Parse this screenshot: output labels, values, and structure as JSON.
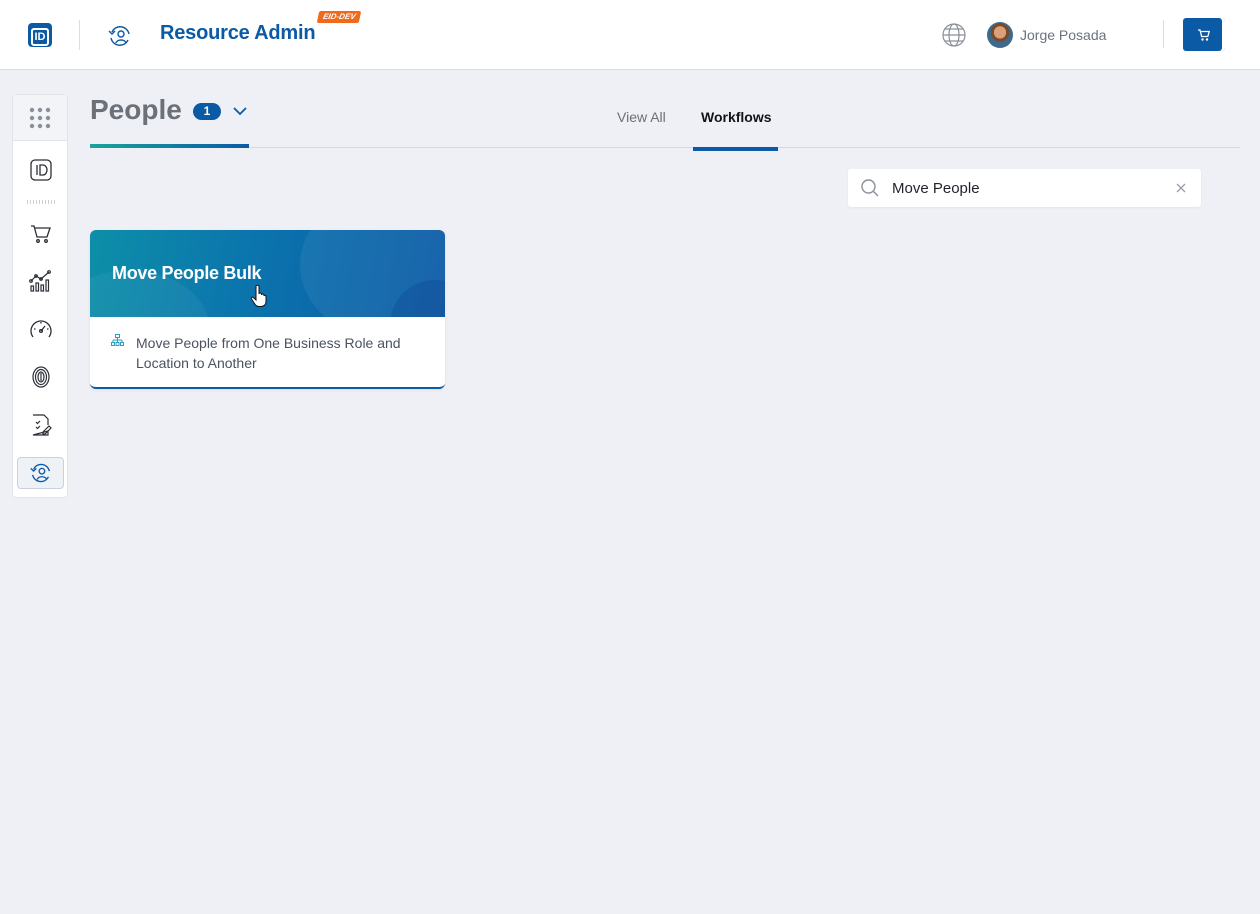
{
  "header": {
    "logo_text": "ID",
    "app_title": "Resource Admin",
    "env_badge": "EID-DEV",
    "user_name": "Jorge Posada"
  },
  "page": {
    "title": "People",
    "count": "1",
    "tabs": [
      {
        "label": "View All",
        "active": false
      },
      {
        "label": "Workflows",
        "active": true
      }
    ]
  },
  "search": {
    "value": "Move People"
  },
  "cards": [
    {
      "title": "Move People Bulk",
      "description": "Move People from One Business Role and Location to Another"
    }
  ],
  "sidebar": {
    "items": [
      {
        "icon": "apps-grid-icon"
      },
      {
        "icon": "id-card-icon"
      },
      {
        "icon": "cart-icon"
      },
      {
        "icon": "analytics-chart-icon"
      },
      {
        "icon": "speedometer-icon"
      },
      {
        "icon": "fingerprint-icon"
      },
      {
        "icon": "checklist-edit-icon"
      },
      {
        "icon": "resource-admin-icon",
        "active": true
      }
    ]
  },
  "colors": {
    "brand": "#0b5aa6",
    "accent_teal": "#1aa39a",
    "badge_orange": "#f06a1b",
    "background": "#eef0f5"
  }
}
